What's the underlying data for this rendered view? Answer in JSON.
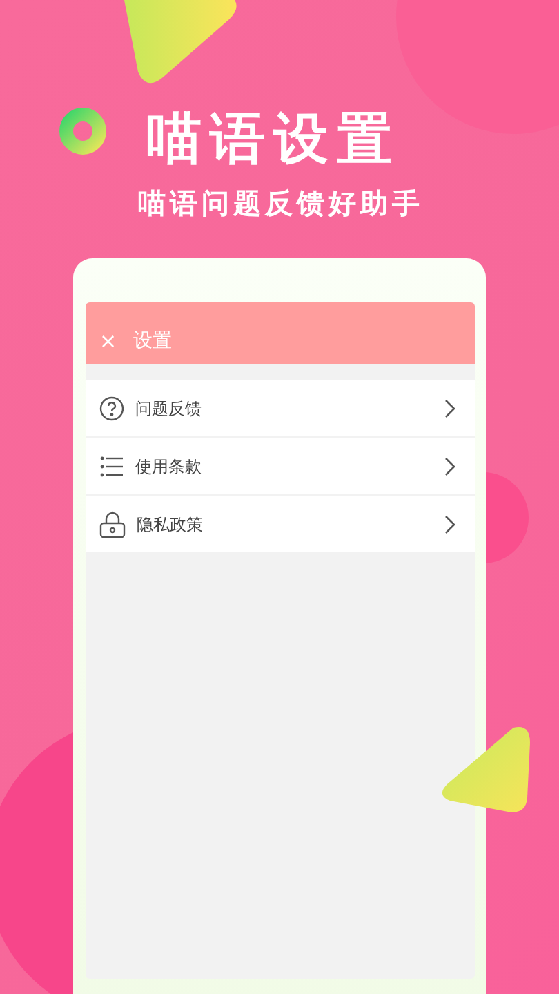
{
  "headline": "喵语设置",
  "subtitle": "喵语问题反馈好助手",
  "app": {
    "header": {
      "close": "×",
      "title": "设置"
    },
    "menu": [
      {
        "kind": "question",
        "label": "问题反馈"
      },
      {
        "kind": "list",
        "label": "使用条款"
      },
      {
        "kind": "lock",
        "label": "隐私政策"
      }
    ]
  }
}
